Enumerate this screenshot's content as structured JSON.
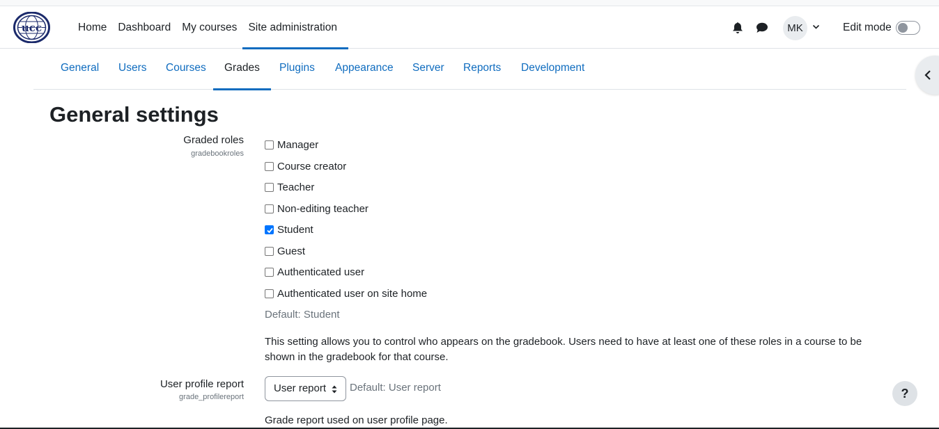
{
  "brand": {
    "logo_alt": "UCC logo"
  },
  "primary_nav": {
    "items": [
      {
        "label": "Home"
      },
      {
        "label": "Dashboard"
      },
      {
        "label": "My courses"
      },
      {
        "label": "Site administration"
      }
    ],
    "active": "Site administration"
  },
  "user_menu": {
    "initials": "MK"
  },
  "edit_mode": {
    "label": "Edit mode",
    "enabled": false
  },
  "secondary_nav": {
    "tabs": [
      {
        "label": "General"
      },
      {
        "label": "Users"
      },
      {
        "label": "Courses"
      },
      {
        "label": "Grades"
      },
      {
        "label": "Plugins"
      },
      {
        "label": "Appearance"
      },
      {
        "label": "Server"
      },
      {
        "label": "Reports"
      },
      {
        "label": "Development"
      }
    ],
    "active": "Grades"
  },
  "page": {
    "title": "General settings"
  },
  "settings": {
    "graded_roles": {
      "label": "Graded roles",
      "key": "gradebookroles",
      "options": [
        {
          "label": "Manager",
          "checked": false
        },
        {
          "label": "Course creator",
          "checked": false
        },
        {
          "label": "Teacher",
          "checked": false
        },
        {
          "label": "Non-editing teacher",
          "checked": false
        },
        {
          "label": "Student",
          "checked": true
        },
        {
          "label": "Guest",
          "checked": false
        },
        {
          "label": "Authenticated user",
          "checked": false
        },
        {
          "label": "Authenticated user on site home",
          "checked": false
        }
      ],
      "default": "Default: Student",
      "description": "This setting allows you to control who appears on the gradebook. Users need to have at least one of these roles in a course to be shown in the gradebook for that course."
    },
    "user_profile_report": {
      "label": "User profile report",
      "key": "grade_profilereport",
      "value": "User report",
      "default": "Default: User report",
      "description": "Grade report used on user profile page."
    }
  },
  "help_button": {
    "label": "?"
  },
  "colors": {
    "accent": "#0f6cbf",
    "text": "#1d2125",
    "muted": "#6a737b",
    "checkbox_checked": "#0075ff"
  },
  "icons": [
    "ucc-logo",
    "bell-icon",
    "chat-icon",
    "chevron-down-icon",
    "chevron-left-icon",
    "select-arrows-icon",
    "checkmark-icon"
  ]
}
